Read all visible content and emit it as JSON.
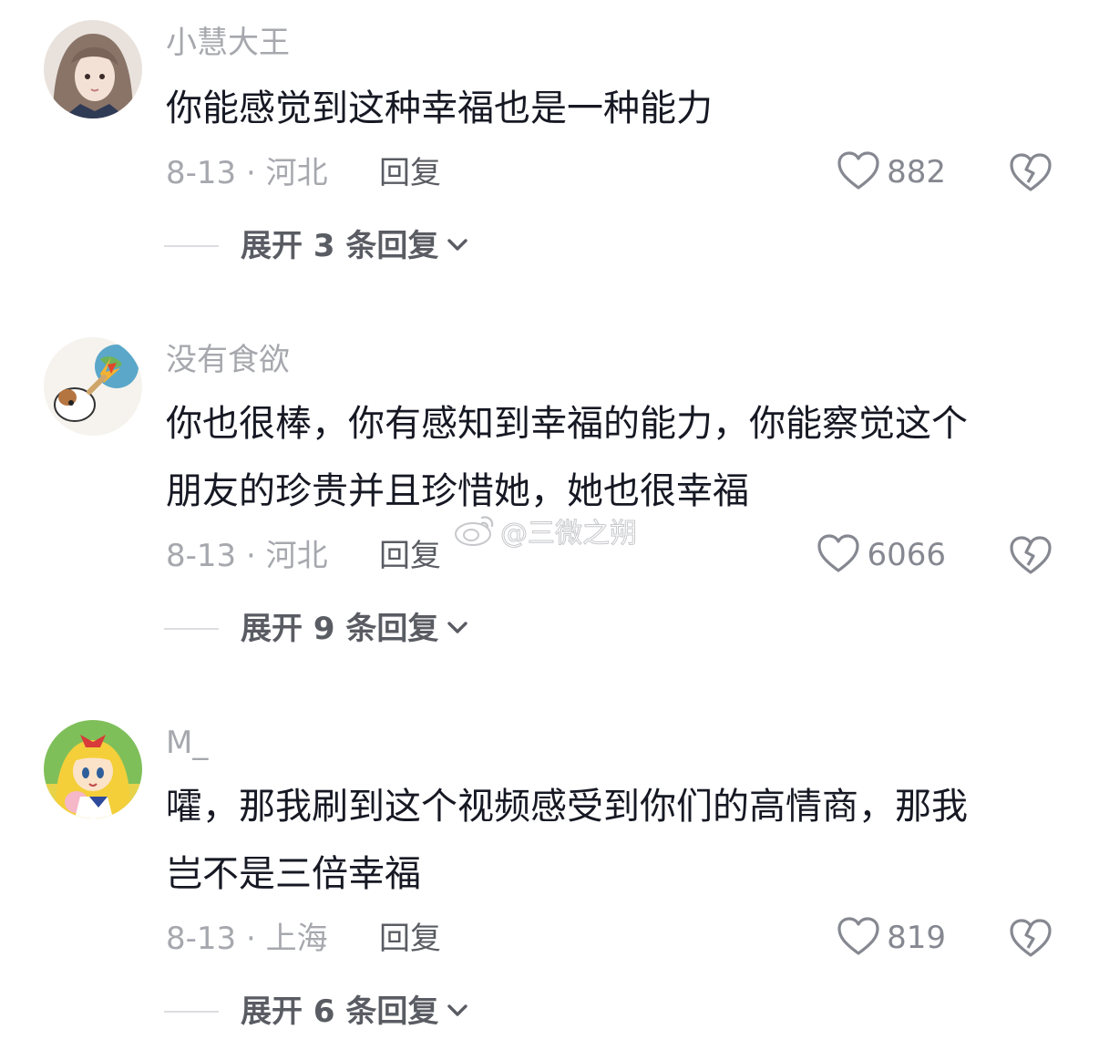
{
  "comments": [
    {
      "username": "小慧大王",
      "text_lines": [
        "你能感觉到这种幸福也是一种能力"
      ],
      "meta": "8-13 · 河北",
      "reply_label": "回复",
      "likes": "882",
      "expand_label": "展开 3 条回复"
    },
    {
      "username": "没有食欲",
      "text_lines": [
        "你也很棒，你有感知到幸福的能力，你能察觉这个",
        "朋友的珍贵并且珍惜她，她也很幸福"
      ],
      "meta": "8-13 · 河北",
      "reply_label": "回复",
      "likes": "6066",
      "expand_label": "展开 9 条回复"
    },
    {
      "username": "M_",
      "text_lines": [
        "嚯，那我刷到这个视频感受到你们的高情商，那我",
        "岂不是三倍幸福"
      ],
      "meta": "8-13 · 上海",
      "reply_label": "回复",
      "likes": "819",
      "expand_label": "展开 6 条回复"
    }
  ],
  "watermark": "@三微之朔",
  "icons": {
    "like": "heart-outline-icon",
    "dislike": "broken-heart-icon",
    "expand": "chevron-down-icon",
    "watermark": "weibo-logo-icon"
  },
  "colors": {
    "text": "#161823",
    "muted": "#a6a8ae",
    "secondary": "#5a5c63"
  }
}
